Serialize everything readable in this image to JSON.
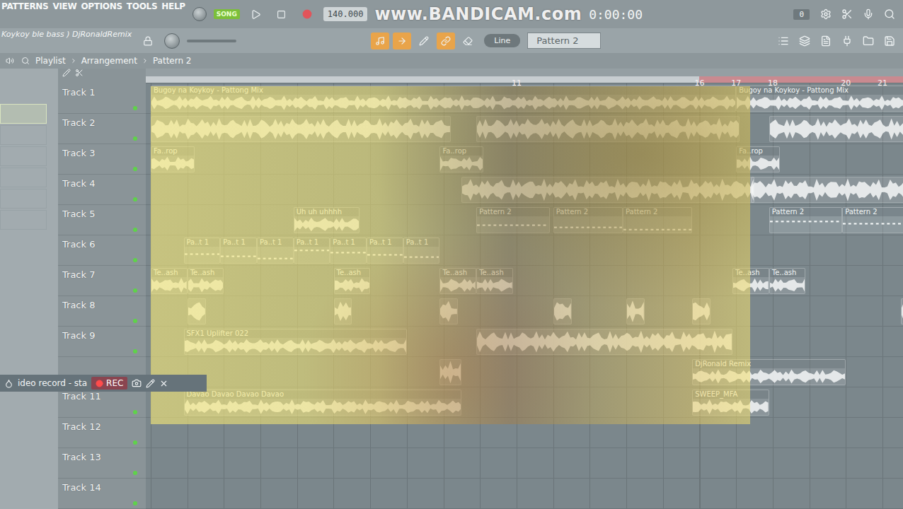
{
  "menu": [
    "PATTERNS",
    "VIEW",
    "OPTIONS",
    "TOOLS",
    "HELP"
  ],
  "mode": {
    "label": "SONG",
    "selected": true
  },
  "tempo": "140.000",
  "watermark": "www.BANDICAM.com",
  "time": "0:00:00",
  "counter": "0",
  "project_title": "Koykoy ble bass ) DjRonaldRemix",
  "snap": "Line",
  "pattern_selector": "Pattern 2",
  "playlist_path": [
    "Playlist",
    "Arrangement",
    "Pattern 2"
  ],
  "ruler": {
    "marks": [
      "11",
      "16",
      "17",
      "18",
      "20",
      "21"
    ],
    "highlight_from": 16
  },
  "tracks": [
    {
      "name": "Track 1",
      "clips": [
        {
          "label": "Bugoy na Koykoy - Pattong Mix",
          "start": 1,
          "length": 16,
          "kind": "audio"
        },
        {
          "label": "Bugoy na Koykoy - Pattong Mix",
          "start": 17,
          "length": 5,
          "kind": "audio"
        }
      ]
    },
    {
      "name": "Track 2",
      "clips": [
        {
          "label": "",
          "start": 1,
          "length": 8.2,
          "kind": "audio"
        },
        {
          "label": "",
          "start": 9.9,
          "length": 7.2,
          "kind": "audio"
        },
        {
          "label": "",
          "start": 17.9,
          "length": 3.9,
          "kind": "audio"
        }
      ]
    },
    {
      "name": "Track 3",
      "clips": [
        {
          "label": "Fa..rop",
          "start": 1,
          "length": 1.2,
          "kind": "audio"
        },
        {
          "label": "Fa..rop",
          "start": 8.9,
          "length": 1.2,
          "kind": "audio"
        },
        {
          "label": "Fa..rop",
          "start": 17,
          "length": 1.2,
          "kind": "audio"
        }
      ]
    },
    {
      "name": "Track 4",
      "clips": [
        {
          "label": "",
          "start": 9.5,
          "length": 8,
          "kind": "audio"
        },
        {
          "label": "",
          "start": 17.4,
          "length": 4.6,
          "kind": "audio"
        }
      ]
    },
    {
      "name": "Track 5",
      "clips": [
        {
          "label": "Uh uh uhhhh",
          "start": 4.9,
          "length": 1.8,
          "kind": "audio"
        },
        {
          "label": "Pattern 2",
          "start": 9.9,
          "length": 2,
          "kind": "pattern"
        },
        {
          "label": "Pattern 2",
          "start": 12,
          "length": 1.9,
          "kind": "pattern"
        },
        {
          "label": "Pattern 2",
          "start": 13.9,
          "length": 1.9,
          "kind": "pattern"
        },
        {
          "label": "Pattern 2",
          "start": 17.9,
          "length": 2,
          "kind": "pattern"
        },
        {
          "label": "Pattern 2",
          "start": 19.9,
          "length": 2,
          "kind": "pattern"
        }
      ]
    },
    {
      "name": "Track 6",
      "clips": [
        {
          "label": "Pa..t 1",
          "start": 1.9,
          "length": 1,
          "kind": "pattern"
        },
        {
          "label": "Pa..t 1",
          "start": 2.9,
          "length": 1,
          "kind": "pattern"
        },
        {
          "label": "Pa..t 1",
          "start": 3.9,
          "length": 1,
          "kind": "pattern"
        },
        {
          "label": "Pa..t 1",
          "start": 4.9,
          "length": 1,
          "kind": "pattern"
        },
        {
          "label": "Pa..t 1",
          "start": 5.9,
          "length": 1,
          "kind": "pattern"
        },
        {
          "label": "Pa..t 1",
          "start": 6.9,
          "length": 1,
          "kind": "pattern"
        },
        {
          "label": "Pa..t 1",
          "start": 7.9,
          "length": 1,
          "kind": "pattern"
        }
      ]
    },
    {
      "name": "Track 7",
      "clips": [
        {
          "label": "Te..ash",
          "start": 1,
          "length": 1,
          "kind": "audio"
        },
        {
          "label": "Te..ash",
          "start": 2,
          "length": 1,
          "kind": "audio"
        },
        {
          "label": "Te..ash",
          "start": 6,
          "length": 1,
          "kind": "audio"
        },
        {
          "label": "Te..ash",
          "start": 8.9,
          "length": 1,
          "kind": "audio"
        },
        {
          "label": "Te..ash",
          "start": 9.9,
          "length": 1,
          "kind": "audio"
        },
        {
          "label": "Te..ash",
          "start": 16.9,
          "length": 1,
          "kind": "audio"
        },
        {
          "label": "Te..ash",
          "start": 17.9,
          "length": 1,
          "kind": "audio"
        }
      ]
    },
    {
      "name": "Track 8",
      "clips": [
        {
          "label": "",
          "start": 2,
          "length": 0.5,
          "kind": "audio"
        },
        {
          "label": "",
          "start": 6,
          "length": 0.5,
          "kind": "audio"
        },
        {
          "label": "",
          "start": 8.9,
          "length": 0.5,
          "kind": "audio"
        },
        {
          "label": "",
          "start": 12,
          "length": 0.5,
          "kind": "audio"
        },
        {
          "label": "",
          "start": 14,
          "length": 0.5,
          "kind": "audio"
        },
        {
          "label": "",
          "start": 15.8,
          "length": 0.5,
          "kind": "audio"
        },
        {
          "label": "",
          "start": 21.5,
          "length": 0.7,
          "kind": "audio"
        }
      ]
    },
    {
      "name": "Track 9",
      "clips": [
        {
          "label": "SFX1 Uplifter 022",
          "start": 1.9,
          "length": 6.1,
          "kind": "audio"
        },
        {
          "label": "",
          "start": 9.9,
          "length": 7,
          "kind": "audio"
        }
      ]
    },
    {
      "name": "",
      "clips": [
        {
          "label": "",
          "start": 8.9,
          "length": 0.6,
          "kind": "audio"
        },
        {
          "label": "DjRonald Remix",
          "start": 15.8,
          "length": 4.2,
          "kind": "audio"
        }
      ]
    },
    {
      "name": "Track 11",
      "clips": [
        {
          "label": "Davao Davao Davao Davao",
          "start": 1.9,
          "length": 7.6,
          "kind": "audio"
        },
        {
          "label": "SWEEP_MFA",
          "start": 15.8,
          "length": 2.1,
          "kind": "audio"
        }
      ]
    },
    {
      "name": "Track 12",
      "clips": []
    },
    {
      "name": "Track 13",
      "clips": []
    },
    {
      "name": "Track 14",
      "clips": []
    }
  ],
  "recorder": {
    "label": "ideo record - sta",
    "button": "REC",
    "recording": true
  }
}
